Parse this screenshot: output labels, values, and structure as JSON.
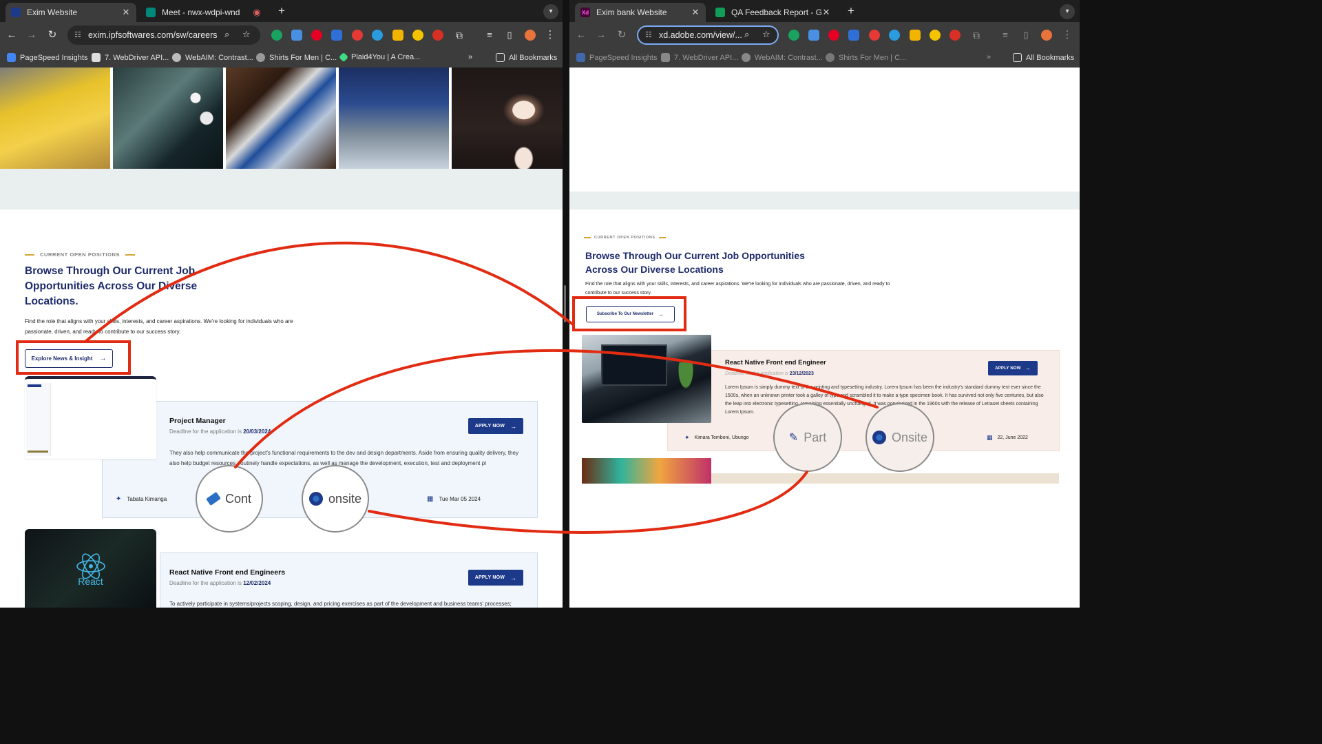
{
  "left": {
    "tabs": [
      {
        "label": "Exim Website",
        "active": true
      },
      {
        "label": "Meet - nwx-wdpi-wnd",
        "active": false
      }
    ],
    "url": "exim.ipfsoftwares.com/sw/careers",
    "bookmarks": [
      "PageSpeed Insights",
      "7. WebDriver API...",
      "WebAIM: Contrast...",
      "Shirts For Men | C...",
      "Plaid4You | A Crea..."
    ],
    "all_bookmarks": "All Bookmarks",
    "section": {
      "eyebrow": "CURRENT OPEN POSITIONS",
      "title": "Browse Through Our Current Job Opportunities Across Our Diverse Locations.",
      "description": "Find the role that aligns with your skills, interests, and career aspirations. We're looking for individuals who are passionate, driven, and ready to contribute to our success story.",
      "cta": "Explore News & Insight"
    },
    "jobs": [
      {
        "title": "Project Manager",
        "deadline_label": "Deadline for the application is",
        "deadline": "20/03/2024",
        "apply": "APPLY NOW",
        "description": "They also help communicate the project's functional requirements to the dev and design departments. Aside from ensuring quality delivery, they also help budget resources, routinely handle expectations, as well as manage the development, execution, test and deployment pl",
        "location": "Tabata Kimanga",
        "date": "Tue Mar 05 2024"
      },
      {
        "title": "React Native Front end Engineers",
        "deadline_label": "Deadline for the application is",
        "deadline": "12/02/2024",
        "apply": "APPLY NOW",
        "description": "To actively participate in systems/projects scoping, design, and pricing exercises as part of the development and business teams' processes;",
        "react_logo_text": "React"
      }
    ],
    "zoom": {
      "type": "Cont",
      "mode": "onsite"
    }
  },
  "right": {
    "tabs": [
      {
        "label": "Exim bank Website",
        "active": true
      },
      {
        "label": "QA Feedback Report - Googl",
        "active": false
      }
    ],
    "url": "xd.adobe.com/view/...",
    "bookmarks": [
      "PageSpeed Insights",
      "7. WebDriver API...",
      "WebAIM: Contrast...",
      "Shirts For Men | C..."
    ],
    "all_bookmarks": "All Bookmarks",
    "section": {
      "eyebrow": "CURRENT OPEN POSITIONS",
      "title": "Browse Through Our Current Job Opportunities Across Our Diverse Locations",
      "description": "Find the role that aligns with your skills, interests, and career aspirations. We're looking for individuals who are passionate, driven, and ready to contribute to our success story.",
      "cta": "Subscribe To Our Newsletter"
    },
    "job": {
      "title": "React Native Front end Engineer",
      "deadline_label": "Deadline for the application is",
      "deadline": "23/12/2023",
      "apply": "APPLY NOW",
      "description": "Lorem Ipsum is simply dummy text of the printing and typesetting industry. Lorem Ipsum has been the industry's standard dummy text ever since the 1500s, when an unknown printer took a galley of type and scrambled it to make a type specimen book. It has survived not only five centuries, but also the leap into electronic typesetting, remaining essentially unchanged. It was popularised in the 1960s with the release of Letraset sheets containing Lorem Ipsum.",
      "location": "Kimara Temboni, Ubungo",
      "type": "Part",
      "mode": "Onsite",
      "date": "22, June 2022"
    }
  }
}
